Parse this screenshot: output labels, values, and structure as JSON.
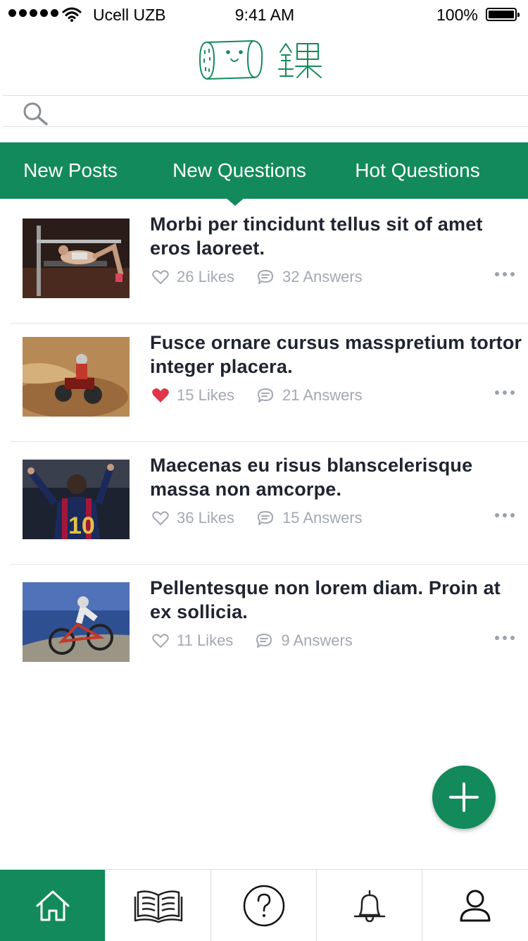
{
  "status_bar": {
    "carrier": "Ucell UZB",
    "time": "9:41 AM",
    "battery": "100%",
    "battery_level": 1.0,
    "signal_icon": "signal-dots-icon",
    "wifi_icon": "wifi-icon"
  },
  "header": {
    "logo_icon": "app-logo-icon"
  },
  "search": {
    "icon": "search-icon",
    "value": "",
    "placeholder": ""
  },
  "tabs": [
    {
      "label": "New Posts"
    },
    {
      "label": "New Questions",
      "selected": true
    },
    {
      "label": "Hot Questions"
    }
  ],
  "posts": [
    {
      "title": "Morbi per tincidunt tellus sit of amet eros laoreet.",
      "likes": "26 Likes",
      "answers": "32 Answers",
      "liked": false,
      "thumb": "gym-photo"
    },
    {
      "title": "Fusce ornare cursus masspretium tortor integer placera.",
      "likes": "15 Likes",
      "answers": "21 Answers",
      "liked": true,
      "thumb": "atv-photo"
    },
    {
      "title": "Maecenas eu risus blanscelerisque massa non amcorpe.",
      "likes": "36 Likes",
      "answers": "15 Answers",
      "liked": false,
      "thumb": "football-photo"
    },
    {
      "title": "Pellentesque non lorem diam. Proin at ex sollicia.",
      "likes": "11 Likes",
      "answers": "9 Answers",
      "liked": false,
      "thumb": "bicycle-photo"
    }
  ],
  "fab": {
    "icon": "plus-icon"
  },
  "bottom_nav": [
    {
      "icon": "home-icon",
      "active": true
    },
    {
      "icon": "book-icon",
      "active": false
    },
    {
      "icon": "question-icon",
      "active": false
    },
    {
      "icon": "bell-icon",
      "active": false
    },
    {
      "icon": "user-icon",
      "active": false
    }
  ],
  "colors": {
    "accent": "#138a5c",
    "liked_heart": "#e0354a",
    "meta_text": "#a3a8b2",
    "title_text": "#1f2430"
  }
}
